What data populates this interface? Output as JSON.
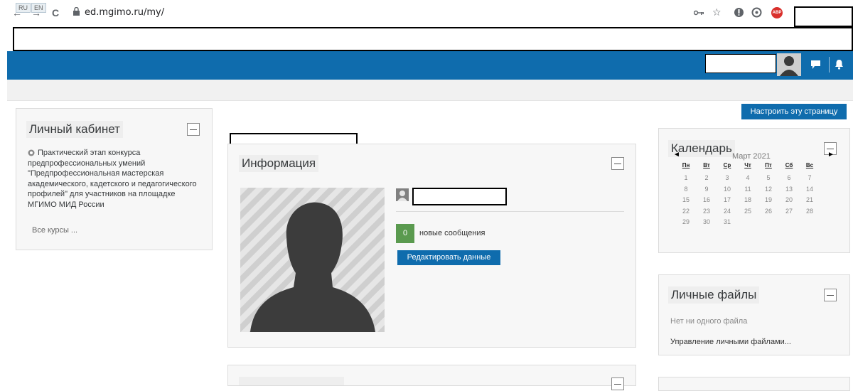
{
  "browser": {
    "back": "←",
    "forward": "→",
    "reload": "C",
    "url": "ed.mgimo.ru/my/",
    "key_icon": "key-icon",
    "star_icon": "star-icon",
    "abp_label": "ABP"
  },
  "navbar": {
    "lang_ru": "RU",
    "lang_en": "EN",
    "colors": {
      "primary": "#0f6cad"
    }
  },
  "header": {
    "customize_label": "Настроить эту страницу"
  },
  "left_block": {
    "title": "Личный кабинет",
    "course_text": "Практический этап конкурса предпрофессиональных умений \"Предпрофессиональная мастерская академического, кадетского и педагогического профилей\" для участников на площадке МГИМО МИД России",
    "all_courses": "Все курсы ..."
  },
  "info_block": {
    "title": "Информация",
    "messages_count": "0",
    "messages_label": "новые сообщения",
    "edit_label": "Редактировать данные"
  },
  "calendar": {
    "title": "Календарь",
    "month": "Март 2021",
    "prev": "◄",
    "next": "►",
    "weekdays": [
      "Пн",
      "Вт",
      "Ср",
      "Чт",
      "Пт",
      "Сб",
      "Вс"
    ],
    "weeks": [
      [
        "1",
        "2",
        "3",
        "4",
        "5",
        "6",
        "7"
      ],
      [
        "8",
        "9",
        "10",
        "11",
        "12",
        "13",
        "14"
      ],
      [
        "15",
        "16",
        "17",
        "18",
        "19",
        "20",
        "21"
      ],
      [
        "22",
        "23",
        "24",
        "25",
        "26",
        "27",
        "28"
      ],
      [
        "29",
        "30",
        "31",
        "",
        "",
        "",
        ""
      ]
    ]
  },
  "files_block": {
    "title": "Личные файлы",
    "empty_text": "Нет ни одного файла",
    "manage_link": "Управление личными файлами..."
  }
}
